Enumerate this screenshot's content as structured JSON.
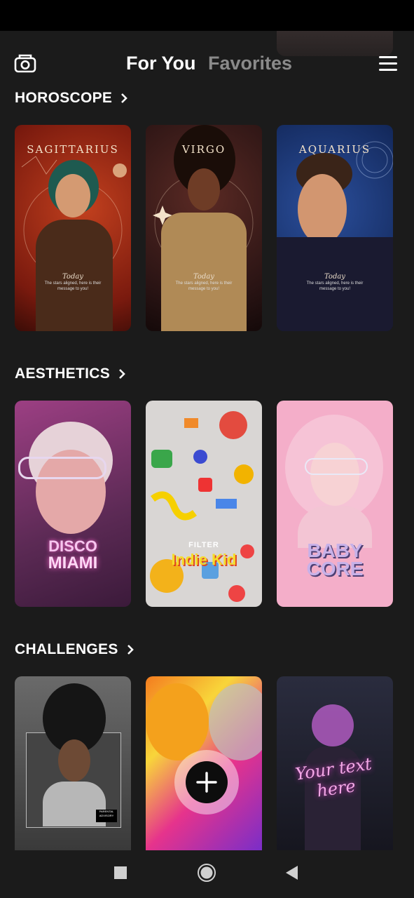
{
  "header": {
    "tabs": [
      {
        "label": "For You",
        "active": true
      },
      {
        "label": "Favorites",
        "active": false
      }
    ]
  },
  "sections": [
    {
      "title": "HOROSCOPE",
      "cards": [
        {
          "sign": "SAGITTARIUS",
          "today": "Today",
          "message": "The stars aligned, here is their message to you!"
        },
        {
          "sign": "VIRGO",
          "today": "Today",
          "message": "The stars aligned, here is their message to you!"
        },
        {
          "sign": "AQUARIUS",
          "today": "Today",
          "message": "The stars aligned, here is their message to you!"
        }
      ]
    },
    {
      "title": "AESTHETICS",
      "cards": [
        {
          "line1": "DISCO",
          "line2": "MIAMI"
        },
        {
          "line1": "FILTER",
          "line2": "Indie Kid"
        },
        {
          "line1": "BABY",
          "line2": "CORE"
        }
      ]
    },
    {
      "title": "CHALLENGES",
      "cards": [
        {
          "badge": "PARENTAL ADVISORY"
        },
        {
          "badge": ""
        },
        {
          "text": "Your text here"
        }
      ]
    }
  ],
  "colors": {
    "background": "#1b1b1b",
    "active_tab": "#ffffff",
    "inactive_tab": "#8a8a8a"
  },
  "icons": {
    "camera": "camera-icon",
    "menu": "hamburger-menu-icon",
    "add": "plus-icon",
    "nav_recents": "square-icon",
    "nav_home": "circle-icon",
    "nav_back": "triangle-back-icon"
  }
}
